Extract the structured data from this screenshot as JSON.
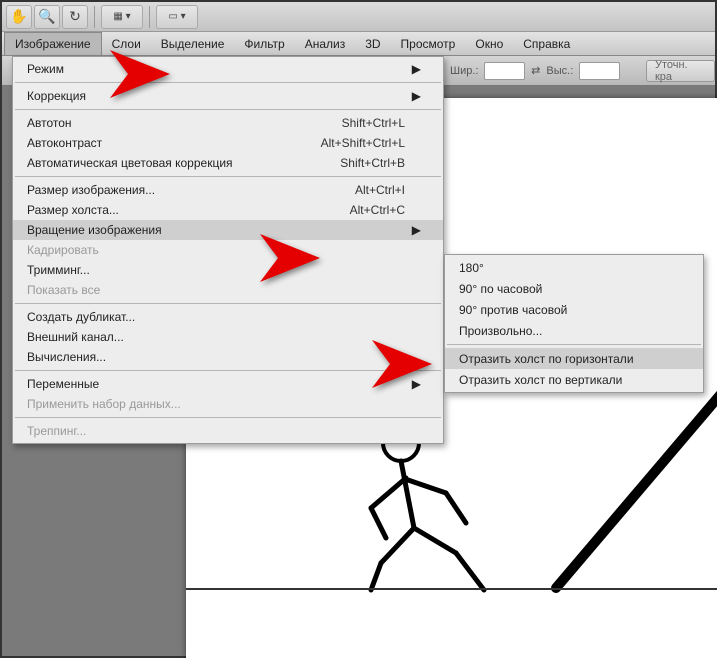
{
  "toolbar": {
    "icons": [
      "hand",
      "zoom",
      "rotate"
    ],
    "dropdowns": [
      "view-mode",
      "screen-mode"
    ]
  },
  "menubar": {
    "items": [
      "Изображение",
      "Слои",
      "Выделение",
      "Фильтр",
      "Анализ",
      "3D",
      "Просмотр",
      "Окно",
      "Справка"
    ]
  },
  "options": {
    "width_label": "Шир.:",
    "swap_icon": "⇄",
    "height_label": "Выс.:",
    "refine_label": "Уточн. кра"
  },
  "menu": {
    "mode": "Режим",
    "correction": "Коррекция",
    "autotone": {
      "label": "Автотон",
      "shortcut": "Shift+Ctrl+L"
    },
    "autocontrast": {
      "label": "Автоконтраст",
      "shortcut": "Alt+Shift+Ctrl+L"
    },
    "autocolor": {
      "label": "Автоматическая цветовая коррекция",
      "shortcut": "Shift+Ctrl+B"
    },
    "image_size": {
      "label": "Размер изображения...",
      "shortcut": "Alt+Ctrl+I"
    },
    "canvas_size": {
      "label": "Размер холста...",
      "shortcut": "Alt+Ctrl+C"
    },
    "rotation": "Вращение изображения",
    "crop": "Кадрировать",
    "trim": "Тримминг...",
    "reveal_all": "Показать все",
    "duplicate": "Создать дубликат...",
    "apply_image": "Внешний канал...",
    "calculations": "Вычисления...",
    "variables": "Переменные",
    "apply_dataset": "Применить набор данных...",
    "trap": "Треппинг..."
  },
  "submenu": {
    "r180": "180°",
    "r90cw": "90° по часовой",
    "r90ccw": "90° против часовой",
    "arbitrary": "Произвольно...",
    "flip_h": "Отразить холст по горизонтали",
    "flip_v": "Отразить холст по вертикали"
  }
}
